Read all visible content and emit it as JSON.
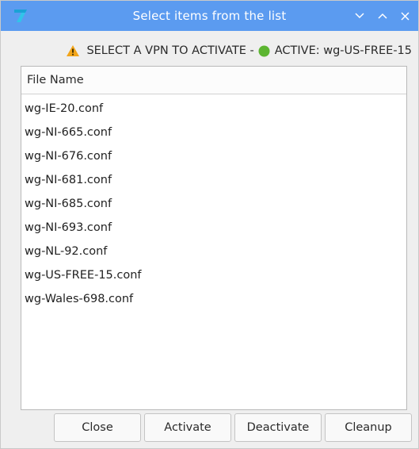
{
  "window": {
    "title": "Select items from the list",
    "icons": {
      "app": "app-logo-icon",
      "minimize": "chevron-down-icon",
      "maximize": "chevron-up-icon",
      "close": "close-icon"
    }
  },
  "header": {
    "warning_icon": "warning-icon",
    "status_icon": "green-dot-icon",
    "prefix": "SELECT A VPN TO ACTIVATE - ",
    "active_text": "ACTIVE: wg-US-FREE-15"
  },
  "list": {
    "column_header": "File Name",
    "items": [
      "wg-IE-20.conf",
      "wg-NI-665.conf",
      "wg-NI-676.conf",
      "wg-NI-681.conf",
      "wg-NI-685.conf",
      "wg-NI-693.conf",
      "wg-NL-92.conf",
      "wg-US-FREE-15.conf",
      "wg-Wales-698.conf"
    ]
  },
  "buttons": {
    "close": "Close",
    "activate": "Activate",
    "deactivate": "Deactivate",
    "cleanup": "Cleanup"
  },
  "colors": {
    "titlebar": "#5b9bf0",
    "warning": "#f2a51a",
    "active_dot": "#5cb531"
  }
}
